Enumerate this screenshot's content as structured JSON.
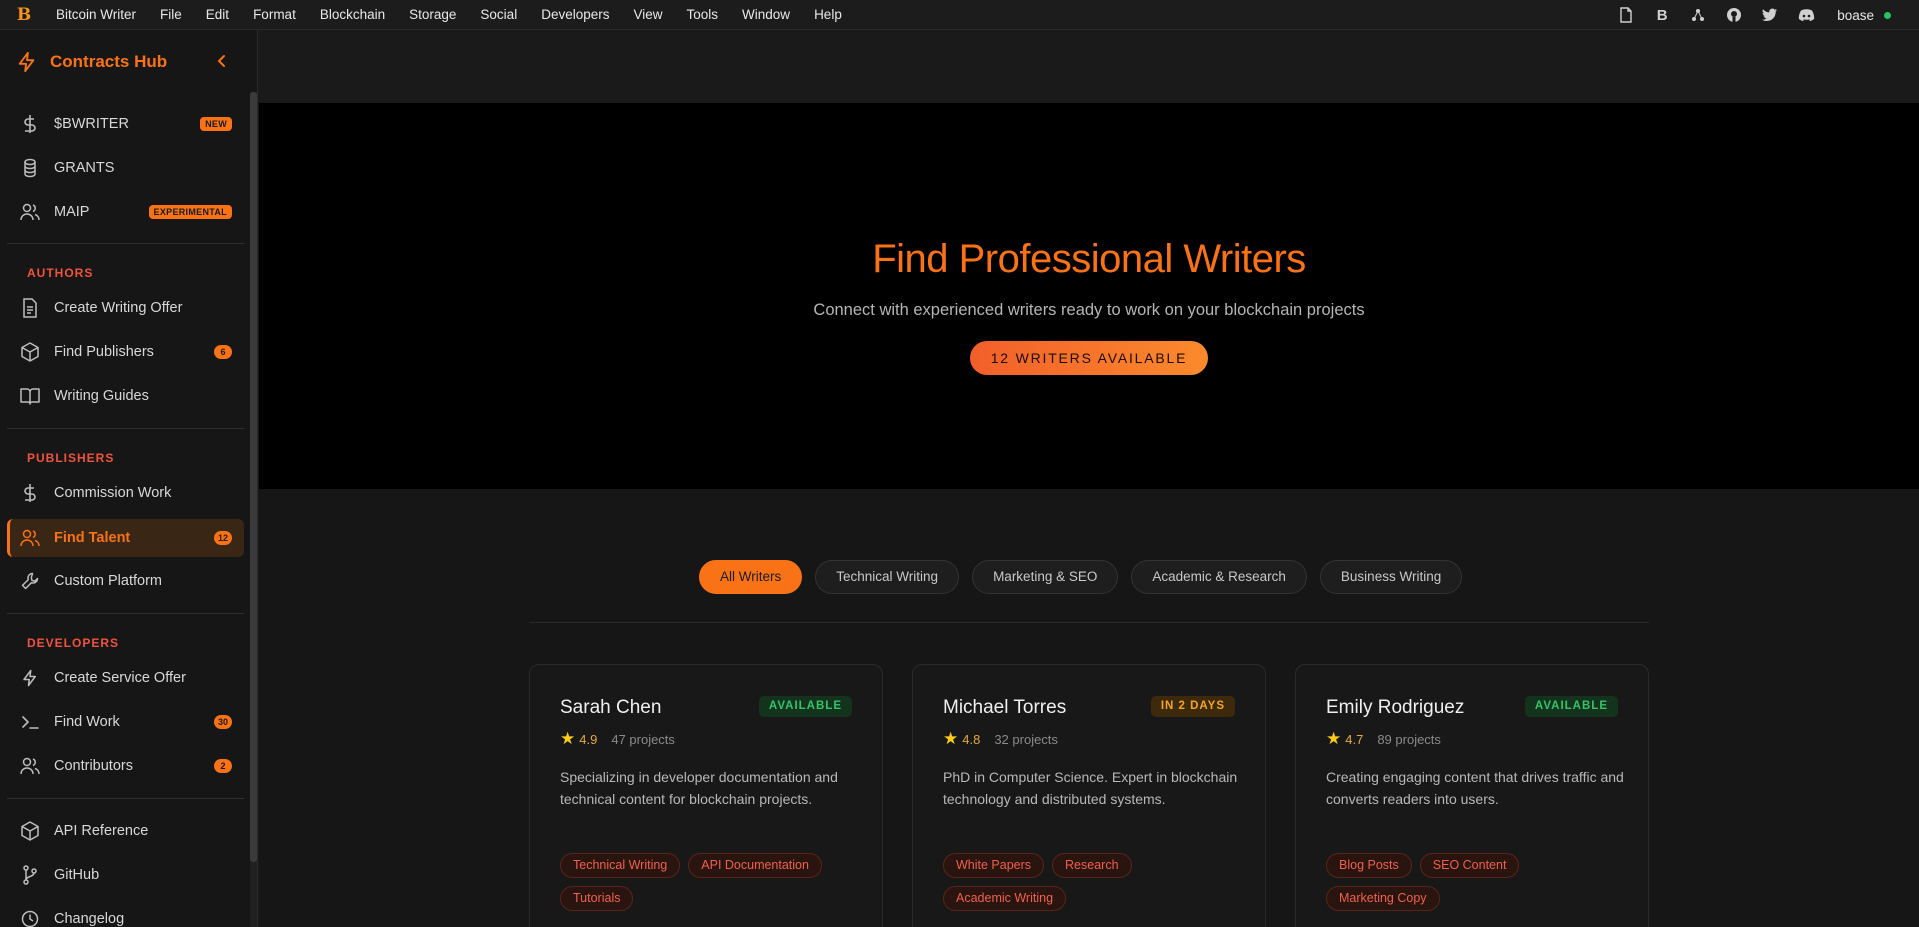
{
  "menubar": {
    "app_name": "Bitcoin Writer",
    "items": [
      "File",
      "Edit",
      "Format",
      "Blockchain",
      "Storage",
      "Social",
      "Developers",
      "View",
      "Tools",
      "Window",
      "Help"
    ],
    "right_icons": [
      "document-icon",
      "bold-b-icon",
      "asterisk-icon",
      "github-icon",
      "twitter-icon",
      "discord-icon"
    ],
    "user": "boase",
    "status_color": "#22c55e"
  },
  "sidebar": {
    "title": "Contracts Hub",
    "top_items": [
      {
        "label": "$BWRITER",
        "badge": "NEW"
      },
      {
        "label": "GRANTS"
      },
      {
        "label": "MAIP",
        "badge": "EXPERIMENTAL"
      }
    ],
    "sections": {
      "authors": {
        "label": "AUTHORS",
        "items": [
          {
            "label": "Create Writing Offer"
          },
          {
            "label": "Find Publishers",
            "count": "6"
          },
          {
            "label": "Writing Guides"
          }
        ]
      },
      "publishers": {
        "label": "PUBLISHERS",
        "items": [
          {
            "label": "Commission Work"
          },
          {
            "label": "Find Talent",
            "count": "12"
          },
          {
            "label": "Custom Platform"
          }
        ]
      },
      "developers": {
        "label": "DEVELOPERS",
        "items": [
          {
            "label": "Create Service Offer"
          },
          {
            "label": "Find Work",
            "count": "30"
          },
          {
            "label": "Contributors",
            "count": "2"
          }
        ]
      }
    },
    "bottom_items": [
      {
        "label": "API Reference"
      },
      {
        "label": "GitHub"
      },
      {
        "label": "Changelog"
      }
    ],
    "accent": "#f97316"
  },
  "hero": {
    "title": "Find Professional Writers",
    "subtitle": "Connect with experienced writers ready to work on your blockchain projects",
    "cta": "12 WRITERS AVAILABLE"
  },
  "filters": [
    "All Writers",
    "Technical Writing",
    "Marketing & SEO",
    "Academic & Research",
    "Business Writing"
  ],
  "active_filter": "All Writers",
  "writers": [
    {
      "name": "Sarah Chen",
      "status": "AVAILABLE",
      "rating": "4.9",
      "projects": "47 projects",
      "description": "Specializing in developer documentation and technical content for blockchain projects.",
      "tags": [
        "Technical Writing",
        "API Documentation",
        "Tutorials"
      ]
    },
    {
      "name": "Michael Torres",
      "status": "IN 2 DAYS",
      "rating": "4.8",
      "projects": "32 projects",
      "description": "PhD in Computer Science. Expert in blockchain technology and distributed systems.",
      "tags": [
        "White Papers",
        "Research",
        "Academic Writing"
      ]
    },
    {
      "name": "Emily Rodriguez",
      "status": "AVAILABLE",
      "rating": "4.7",
      "projects": "89 projects",
      "description": "Creating engaging content that drives traffic and converts readers into users.",
      "tags": [
        "Blog Posts",
        "SEO Content",
        "Marketing Copy"
      ]
    }
  ]
}
